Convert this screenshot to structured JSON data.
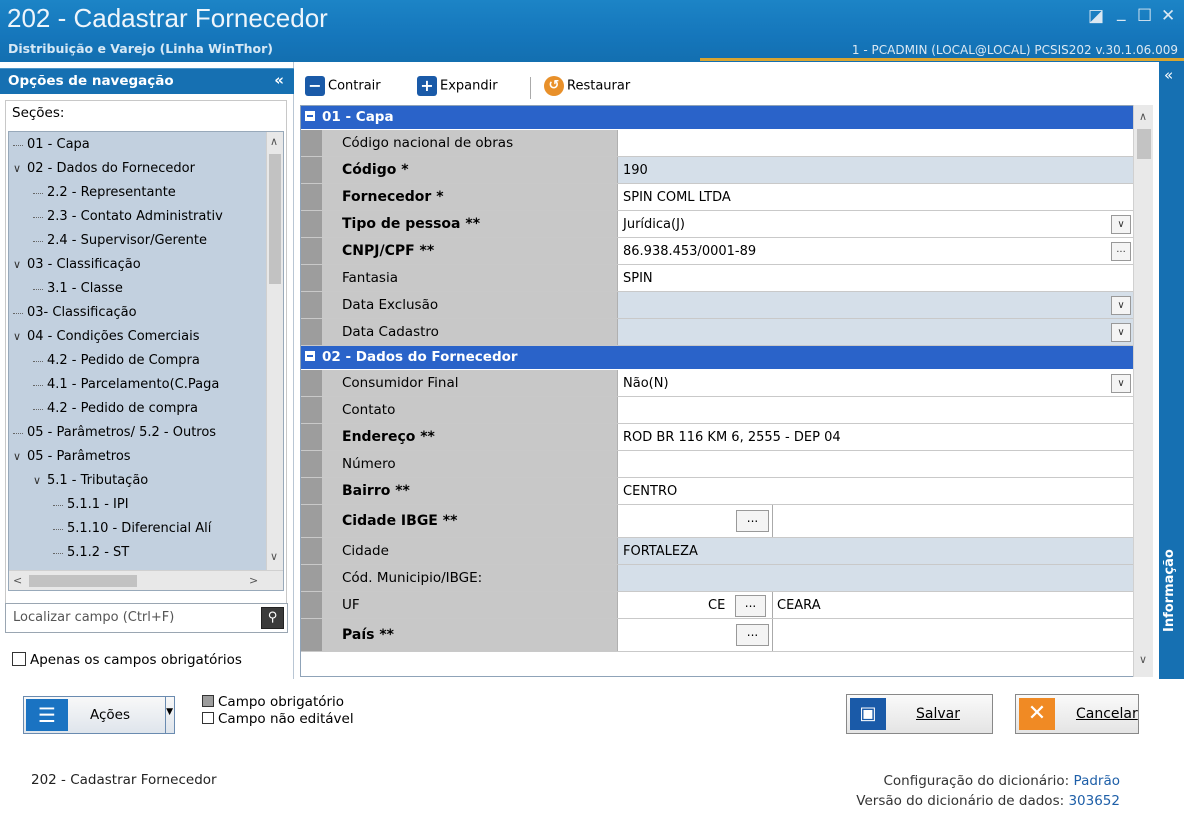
{
  "titlebar": {
    "title": "202 - Cadastrar  Fornecedor",
    "subtitle": "Distribuição e Varejo (Linha WinThor)",
    "user_info": "1 - PCADMIN (LOCAL@LOCAL)  PCSIS202  v.30.1.06.009"
  },
  "nav": {
    "header": "Opções de navegação",
    "collapse": "«",
    "sections_label": "Seções:",
    "tree": [
      {
        "label": "01 - Capa",
        "level": 0,
        "expanded": null
      },
      {
        "label": "02 - Dados do Fornecedor",
        "level": 0,
        "expanded": true
      },
      {
        "label": "2.2 - Representante",
        "level": 1,
        "expanded": null
      },
      {
        "label": "2.3 - Contato Administrativ",
        "level": 1,
        "expanded": null
      },
      {
        "label": "2.4 - Supervisor/Gerente",
        "level": 1,
        "expanded": null
      },
      {
        "label": "03 - Classificação",
        "level": 0,
        "expanded": true
      },
      {
        "label": "3.1 - Classe",
        "level": 1,
        "expanded": null
      },
      {
        "label": "03- Classificação",
        "level": 0,
        "expanded": null
      },
      {
        "label": "04 - Condições Comerciais",
        "level": 0,
        "expanded": true
      },
      {
        "label": "4.2 - Pedido de Compra",
        "level": 1,
        "expanded": null
      },
      {
        "label": "4.1 - Parcelamento(C.Paga",
        "level": 1,
        "expanded": null
      },
      {
        "label": "4.2 - Pedido de compra",
        "level": 1,
        "expanded": null
      },
      {
        "label": "05 - Parâmetros/ 5.2 - Outros",
        "level": 0,
        "expanded": null
      },
      {
        "label": "05 - Parâmetros",
        "level": 0,
        "expanded": true
      },
      {
        "label": "5.1 - Tributação",
        "level": 1,
        "expanded": true
      },
      {
        "label": "5.1.1 - IPI",
        "level": 2,
        "expanded": null
      },
      {
        "label": "5.1.10 - Diferencial Alí",
        "level": 2,
        "expanded": null
      },
      {
        "label": "5.1.2 - ST",
        "level": 2,
        "expanded": null
      }
    ],
    "search_placeholder": "Localizar campo (Ctrl+F)",
    "only_required_label": "Apenas os campos obrigatórios"
  },
  "toolbar": {
    "collapse_label": "Contrair",
    "expand_label": "Expandir",
    "restore_label": "Restaurar"
  },
  "grid": {
    "sections": [
      {
        "title": "01 - Capa",
        "rows": [
          {
            "label": "Código nacional de obras",
            "value": "",
            "bold": false,
            "readonly": false,
            "control": null
          },
          {
            "label": "Código *",
            "value": "190",
            "bold": true,
            "readonly": true,
            "control": null
          },
          {
            "label": "Fornecedor *",
            "value": "SPIN COML LTDA",
            "bold": true,
            "readonly": false,
            "control": null
          },
          {
            "label": "Tipo de pessoa **",
            "value": "Jurídica(J)",
            "bold": true,
            "readonly": false,
            "control": "dropdown"
          },
          {
            "label": "CNPJ/CPF **",
            "value": "86.938.453/0001-89",
            "bold": true,
            "readonly": false,
            "control": "ellipsis"
          },
          {
            "label": "Fantasia",
            "value": "SPIN",
            "bold": false,
            "readonly": false,
            "control": null
          },
          {
            "label": "Data Exclusão",
            "value": "",
            "bold": false,
            "readonly": true,
            "control": "dropdown"
          },
          {
            "label": "Data Cadastro",
            "value": "",
            "bold": false,
            "readonly": true,
            "control": "dropdown"
          }
        ]
      },
      {
        "title": "02 - Dados do Fornecedor",
        "rows": [
          {
            "label": "Consumidor Final",
            "value": "Não(N)",
            "bold": false,
            "readonly": false,
            "control": "dropdown"
          },
          {
            "label": "Contato",
            "value": "",
            "bold": false,
            "readonly": false,
            "control": null
          },
          {
            "label": "Endereço **",
            "value": "ROD BR 116 KM 6, 2555 - DEP 04",
            "bold": true,
            "readonly": false,
            "control": null
          },
          {
            "label": "Número",
            "value": "",
            "bold": false,
            "readonly": false,
            "control": null
          },
          {
            "label": "Bairro **",
            "value": "CENTRO",
            "bold": true,
            "readonly": false,
            "control": null
          },
          {
            "label": "Cidade IBGE **",
            "value": "",
            "bold": true,
            "readonly": false,
            "control": "lookup"
          },
          {
            "label": "Cidade",
            "value": "FORTALEZA",
            "bold": false,
            "readonly": true,
            "control": null
          },
          {
            "label": "Cód. Municipio/IBGE:",
            "value": "",
            "bold": false,
            "readonly": true,
            "control": null
          },
          {
            "label": "UF",
            "value": "CEARA",
            "code": "CE",
            "bold": false,
            "readonly": false,
            "control": "uf"
          },
          {
            "label": "País **",
            "value": "",
            "bold": true,
            "readonly": false,
            "control": "lookup"
          }
        ]
      }
    ]
  },
  "info_bar": "Informação",
  "actions": {
    "acoes_label": "Ações",
    "legend_required": "Campo obrigatório",
    "legend_readonly": "Campo não editável",
    "save_label": "Salvar",
    "cancel_label": "Cancelar"
  },
  "footer": {
    "screen": "202 - Cadastrar  Fornecedor",
    "dict_config_label": "Configuração do dicionário:",
    "dict_config_value": "Padrão",
    "dict_version_label": "Versão do dicionário de dados:",
    "dict_version_value": "303652"
  },
  "colors": {
    "titlebar": "#1576bb",
    "section_header": "#2a63c9",
    "label_bg": "#c8c8c8",
    "readonly_bg": "#d5dfe9",
    "tree_bg": "#c2d0df"
  }
}
